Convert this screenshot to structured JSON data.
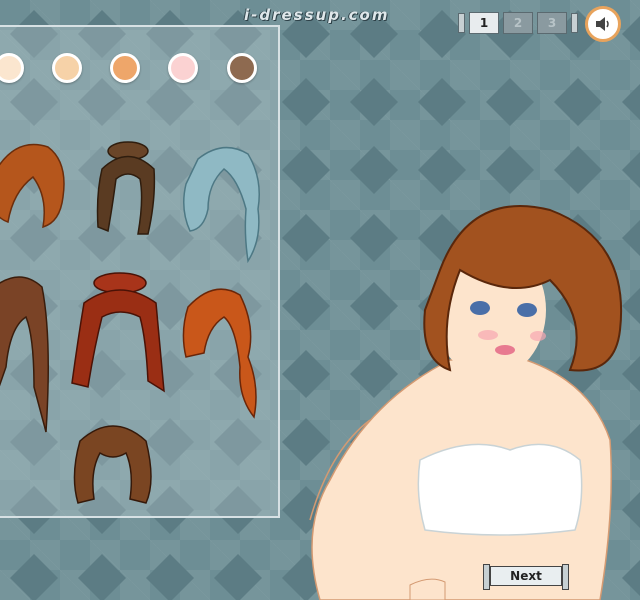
{
  "header": {
    "site_logo": "i-dressup.com"
  },
  "step_nav": {
    "steps": [
      {
        "label": "1",
        "active": true
      },
      {
        "label": "2",
        "active": false
      },
      {
        "label": "3",
        "active": false
      }
    ]
  },
  "sound_button": {
    "icon": "speaker-icon"
  },
  "skin_tones": [
    "#fbe6cf",
    "#f6d2a8",
    "#eea66a",
    "#fbd2d2",
    "#8e6a50"
  ],
  "hairstyles": [
    {
      "name": "auburn-bob",
      "color": "#b5561c"
    },
    {
      "name": "brown-updo",
      "color": "#5a3b22"
    },
    {
      "name": "blue-wavy",
      "color": "#8fb9c4"
    },
    {
      "name": "long-brown-straight",
      "color": "#7a4326"
    },
    {
      "name": "red-long-pigtails",
      "color": "#9a2e14"
    },
    {
      "name": "orange-wavy",
      "color": "#c9571a"
    },
    {
      "name": "brown-bob-bangs",
      "color": "#7a4522"
    }
  ],
  "colors": {
    "background": "#6d8e95",
    "accent_orange": "#e8a35c",
    "model_hair": "#a2521f",
    "model_skin": "#fde4cc"
  },
  "footer": {
    "next_label": "Next"
  }
}
